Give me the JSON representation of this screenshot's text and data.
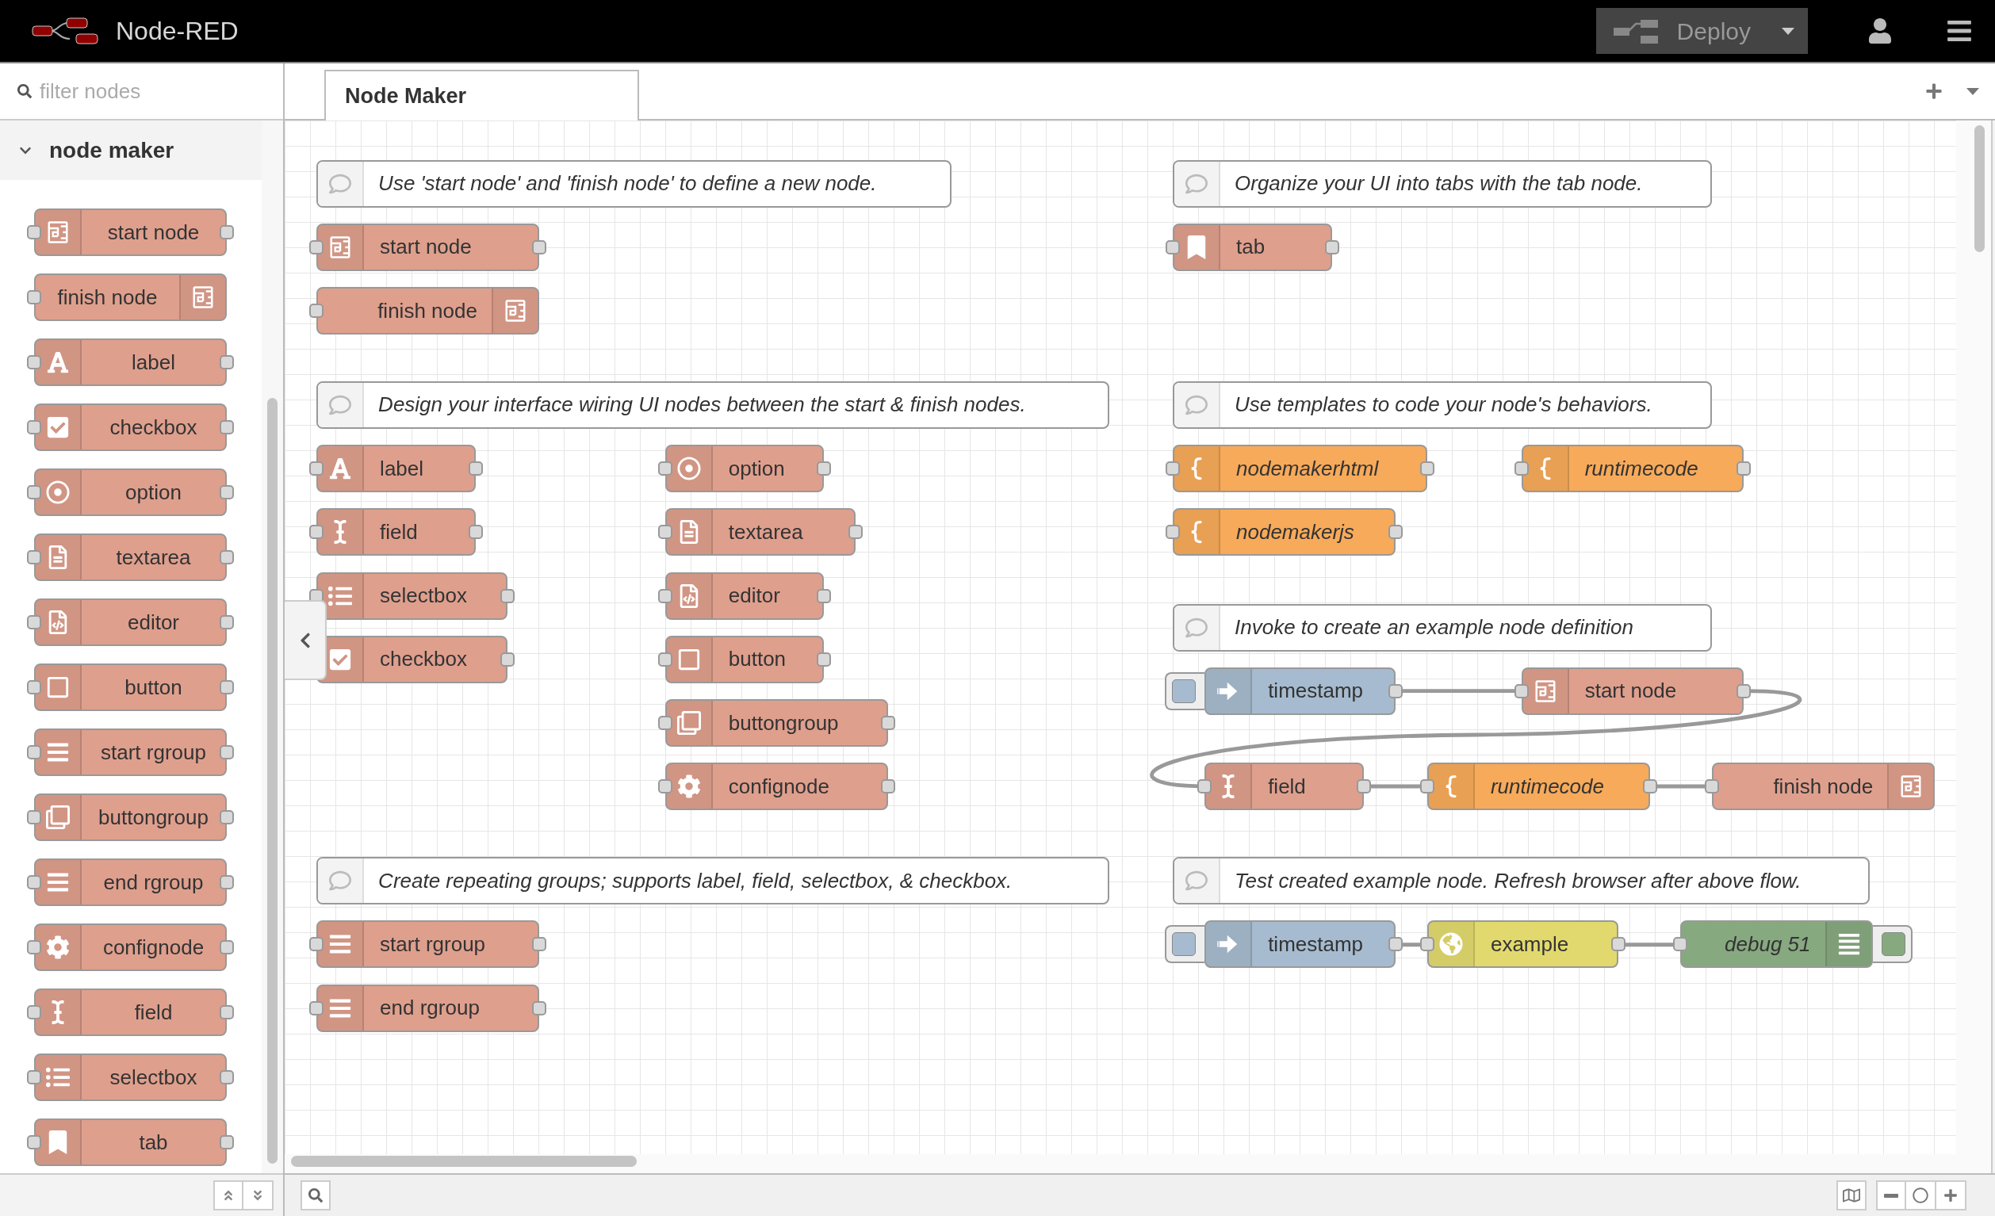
{
  "header": {
    "title": "Node-RED",
    "deploy": {
      "label": "Deploy"
    }
  },
  "palette": {
    "search": {
      "placeholder": "filter nodes"
    },
    "categories": [
      {
        "label": "node maker",
        "expanded": true,
        "nodes": [
          {
            "label": "start node",
            "kind": "start"
          },
          {
            "label": "finish node",
            "kind": "finish"
          },
          {
            "label": "label",
            "kind": "label"
          },
          {
            "label": "checkbox",
            "kind": "checkbox"
          },
          {
            "label": "option",
            "kind": "option"
          },
          {
            "label": "textarea",
            "kind": "textarea"
          },
          {
            "label": "editor",
            "kind": "editor"
          },
          {
            "label": "button",
            "kind": "button"
          },
          {
            "label": "start rgroup",
            "kind": "rgroupstart"
          },
          {
            "label": "buttongroup",
            "kind": "buttongroup"
          },
          {
            "label": "end rgroup",
            "kind": "rgroupend"
          },
          {
            "label": "confignode",
            "kind": "confignode"
          },
          {
            "label": "field",
            "kind": "field"
          },
          {
            "label": "selectbox",
            "kind": "selectbox"
          },
          {
            "label": "tab",
            "kind": "tab"
          }
        ]
      }
    ]
  },
  "workspace": {
    "tabs": [
      {
        "label": "Node Maker",
        "selected": true
      }
    ],
    "canvas": {
      "comments": [
        {
          "text": "Use 'start node' and 'finish node' to define a new node."
        },
        {
          "text": "Organize your UI into tabs with the tab node."
        },
        {
          "text": "Design your interface wiring UI nodes between the start & finish nodes."
        },
        {
          "text": "Use templates to code your node's behaviors."
        },
        {
          "text": "Invoke to create an example node definition"
        },
        {
          "text": "Create repeating groups; supports label, field, selectbox, & checkbox."
        },
        {
          "text": "Test created example node. Refresh browser after above flow."
        }
      ],
      "nodes": [
        {
          "label": "start node",
          "kind": "start"
        },
        {
          "label": "finish node",
          "kind": "finish"
        },
        {
          "label": "tab",
          "kind": "tab"
        },
        {
          "label": "label",
          "kind": "label"
        },
        {
          "label": "field",
          "kind": "field"
        },
        {
          "label": "selectbox",
          "kind": "selectbox"
        },
        {
          "label": "checkbox",
          "kind": "checkbox"
        },
        {
          "label": "start rgroup",
          "kind": "rgroupstart"
        },
        {
          "label": "end rgroup",
          "kind": "rgroupend"
        },
        {
          "label": "option",
          "kind": "option"
        },
        {
          "label": "textarea",
          "kind": "textarea"
        },
        {
          "label": "editor",
          "kind": "editor"
        },
        {
          "label": "button",
          "kind": "button"
        },
        {
          "label": "buttongroup",
          "kind": "buttongroup"
        },
        {
          "label": "confignode",
          "kind": "confignode"
        },
        {
          "label": "nodemakerhtml",
          "kind": "template"
        },
        {
          "label": "runtimecode",
          "kind": "template"
        },
        {
          "label": "nodemakerjs",
          "kind": "template"
        },
        {
          "label": "timestamp",
          "kind": "inject"
        },
        {
          "label": "start node",
          "kind": "start"
        },
        {
          "label": "field",
          "kind": "field"
        },
        {
          "label": "runtimecode",
          "kind": "template"
        },
        {
          "label": "finish node",
          "kind": "finish"
        },
        {
          "label": "timestamp",
          "kind": "inject"
        },
        {
          "label": "example",
          "kind": "example"
        },
        {
          "label": "debug 51",
          "kind": "debug"
        }
      ]
    }
  }
}
